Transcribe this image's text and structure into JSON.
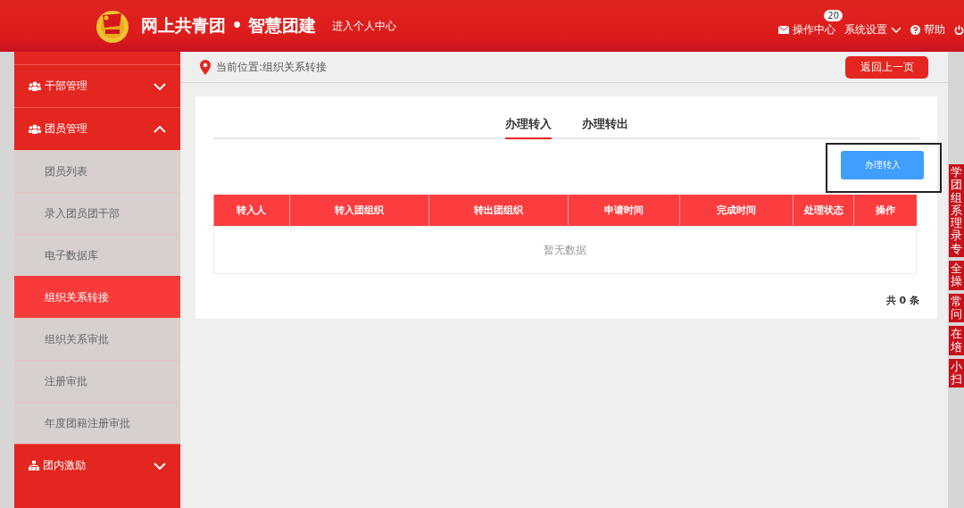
{
  "header": {
    "title": "网上共青团 • 智慧团建",
    "personal_link": "进入个人中心",
    "nav": [
      {
        "kind": "mail",
        "label": "操作中心",
        "badge": "20"
      },
      {
        "kind": "dropdown",
        "label": "系统设置"
      },
      {
        "kind": "help",
        "label": "帮助"
      },
      {
        "kind": "power"
      }
    ]
  },
  "sidebar": {
    "items": [
      {
        "kind": "group",
        "label": "干部管理",
        "expanded": false
      },
      {
        "kind": "group",
        "label": "团员管理",
        "expanded": true
      },
      {
        "kind": "sub",
        "label": "团员列表",
        "selected": false
      },
      {
        "kind": "sub",
        "label": "录入团员团干部",
        "selected": false
      },
      {
        "kind": "sub",
        "label": "电子数据库",
        "selected": false
      },
      {
        "kind": "sub",
        "label": "组织关系转接",
        "selected": true
      },
      {
        "kind": "sub",
        "label": "组织关系审批",
        "selected": false
      },
      {
        "kind": "sub",
        "label": "注册审批",
        "selected": false
      },
      {
        "kind": "sub",
        "label": "年度团籍注册审批",
        "selected": false
      },
      {
        "kind": "group",
        "label": "团内激励",
        "expanded": false
      }
    ]
  },
  "breadcrumb": "当前位置:组织关系转接",
  "back_button": "返回上一页",
  "tabs": [
    {
      "label": "办理转入",
      "selected": true
    },
    {
      "label": "办理转出",
      "selected": false
    }
  ],
  "action_button": "办理转入",
  "table": {
    "columns": [
      "转入人",
      "转入团组织",
      "转出团组织",
      "申请时间",
      "完成时间",
      "处理状态",
      "操作"
    ],
    "empty_text": "暂无数据"
  },
  "total": "共 0 条",
  "side_tabs": [
    "学团组系理录专",
    "全操",
    "常问",
    "在培",
    "小扫"
  ]
}
